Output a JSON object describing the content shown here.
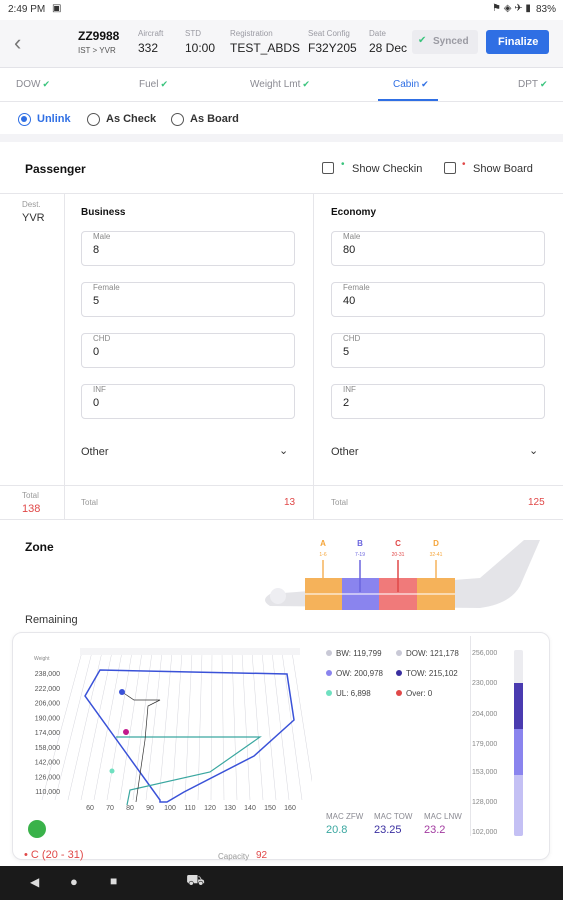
{
  "status": {
    "time": "2:49 PM",
    "battery": "83%"
  },
  "header": {
    "flight": "ZZ9988",
    "route": "IST > YVR",
    "fields": [
      {
        "label": "Aircraft",
        "value": "332"
      },
      {
        "label": "STD",
        "value": "10:00"
      },
      {
        "label": "Registration",
        "value": "TEST_ABDS"
      },
      {
        "label": "Seat Config",
        "value": "F32Y205"
      },
      {
        "label": "Date",
        "value": "28 Dec"
      }
    ],
    "synced_label": "Synced",
    "finalize_label": "Finalize"
  },
  "tabs": [
    "DOW",
    "Fuel",
    "Weight Lmt",
    "Cabin",
    "DPT"
  ],
  "mode_options": [
    "Unlink",
    "As Check",
    "As Board"
  ],
  "passenger": {
    "title": "Passenger",
    "show_checkin": "Show Checkin",
    "show_board": "Show Board",
    "dest_label": "Dest.",
    "dest_value": "YVR",
    "business": {
      "title": "Business",
      "fields": [
        {
          "label": "Male",
          "value": "8"
        },
        {
          "label": "Female",
          "value": "5"
        },
        {
          "label": "CHD",
          "value": "0"
        },
        {
          "label": "INF",
          "value": "0"
        }
      ],
      "other_label": "Other",
      "total_label": "Total",
      "total_value": "13"
    },
    "economy": {
      "title": "Economy",
      "fields": [
        {
          "label": "Male",
          "value": "80"
        },
        {
          "label": "Female",
          "value": "40"
        },
        {
          "label": "CHD",
          "value": "5"
        },
        {
          "label": "INF",
          "value": "2"
        }
      ],
      "other_label": "Other",
      "total_label": "Total",
      "total_value": "125"
    },
    "grand_total_label": "Total",
    "grand_total_value": "138"
  },
  "zone": {
    "title": "Zone",
    "markers": [
      {
        "letter": "A",
        "range": "1-6"
      },
      {
        "letter": "B",
        "range": "7-19"
      },
      {
        "letter": "C",
        "range": "20-31"
      },
      {
        "letter": "D",
        "range": "32-41"
      }
    ],
    "remaining_label": "Remaining",
    "bottom_zone_label": "C (20 - 31)",
    "capacity_label": "Capacity",
    "capacity_value": "92"
  },
  "colors": {
    "accent": "#2f6fe4",
    "zone_a": "#f5b25a",
    "zone_b": "#8a84ee",
    "zone_c": "#f07a7a",
    "zone_d": "#f5b25a",
    "green": "#3ac47d",
    "red": "#e04848"
  },
  "chart_data": {
    "type": "scatter",
    "title": "",
    "xlabel": "",
    "ylabel": "Weight",
    "x_ticks": [
      "60",
      "70",
      "80",
      "90",
      "100",
      "110",
      "120",
      "130",
      "140",
      "150",
      "160"
    ],
    "y_ticks": [
      "110,000",
      "126,000",
      "142,000",
      "158,000",
      "174,000",
      "190,000",
      "206,000",
      "222,000",
      "238,000"
    ],
    "legend": [
      {
        "label": "BW: 119,799",
        "color": "#c9c9d6"
      },
      {
        "label": "DOW: 121,178",
        "color": "#c9c9d6"
      },
      {
        "label": "OW: 200,978",
        "color": "#8a84ee"
      },
      {
        "label": "TOW: 215,102",
        "color": "#3a2fa0"
      },
      {
        "label": "UL: 6,898",
        "color": "#6fe0c0"
      },
      {
        "label": "Over: 0",
        "color": "#e04848"
      }
    ],
    "mac": [
      {
        "label": "MAC ZFW",
        "value": "20.8",
        "color": "#3aa7a0"
      },
      {
        "label": "MAC TOW",
        "value": "23.25",
        "color": "#3a2fa0"
      },
      {
        "label": "MAC LNW",
        "value": "23.2",
        "color": "#a23aa0"
      }
    ],
    "vertical_scale": [
      "256,000",
      "230,000",
      "204,000",
      "179,000",
      "153,000",
      "128,000",
      "102,000"
    ],
    "bar_level": 0.82
  }
}
